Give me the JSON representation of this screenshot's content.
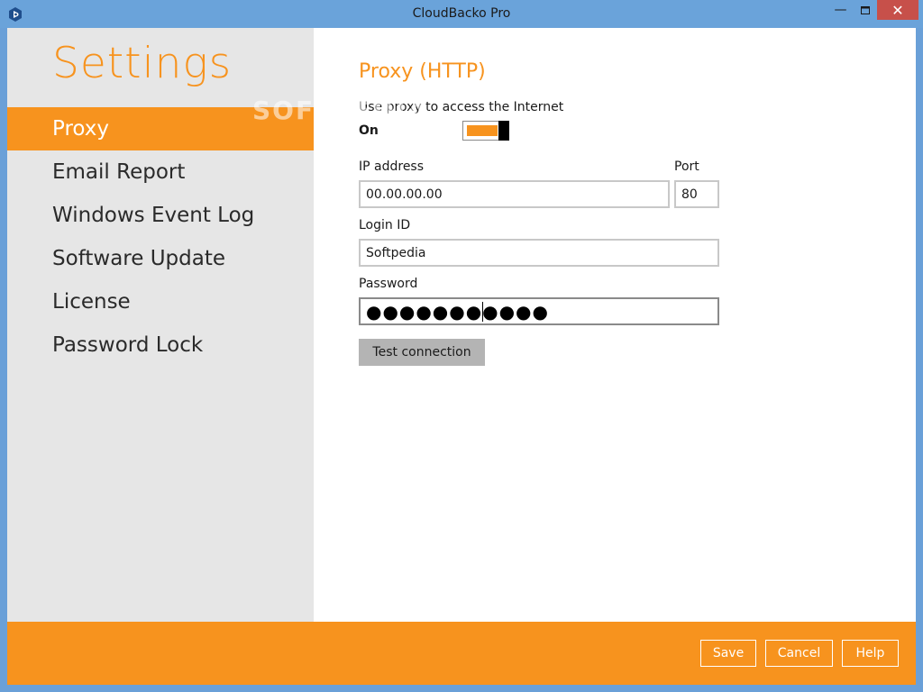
{
  "window": {
    "title": "CloudBacko Pro",
    "minimize_glyph": "—",
    "maximize_glyph": "▫",
    "close_glyph": "✕"
  },
  "sidebar": {
    "title": "Settings",
    "items": [
      {
        "label": "Proxy",
        "active": true
      },
      {
        "label": "Email Report",
        "active": false
      },
      {
        "label": "Windows Event Log",
        "active": false
      },
      {
        "label": "Software Update",
        "active": false
      },
      {
        "label": "License",
        "active": false
      },
      {
        "label": "Password Lock",
        "active": false
      }
    ]
  },
  "proxy": {
    "section_title": "Proxy (HTTP)",
    "use_proxy_label": "Use proxy to access the Internet",
    "toggle_state_label": "On",
    "toggle_on": true,
    "ip_label": "IP address",
    "ip_value": "00.00.00.00",
    "port_label": "Port",
    "port_value": "80",
    "login_label": "Login ID",
    "login_value": "Softpedia",
    "password_label": "Password",
    "password_masked": "●●●●●●●●●●●",
    "test_button": "Test connection"
  },
  "footer": {
    "save": "Save",
    "cancel": "Cancel",
    "help": "Help"
  },
  "watermark": "SOFTPEDIA",
  "colors": {
    "accent": "#f7931e",
    "titlebar": "#6aa3da",
    "sidebar_bg": "#e6e6e6",
    "close_button": "#c7504a"
  }
}
